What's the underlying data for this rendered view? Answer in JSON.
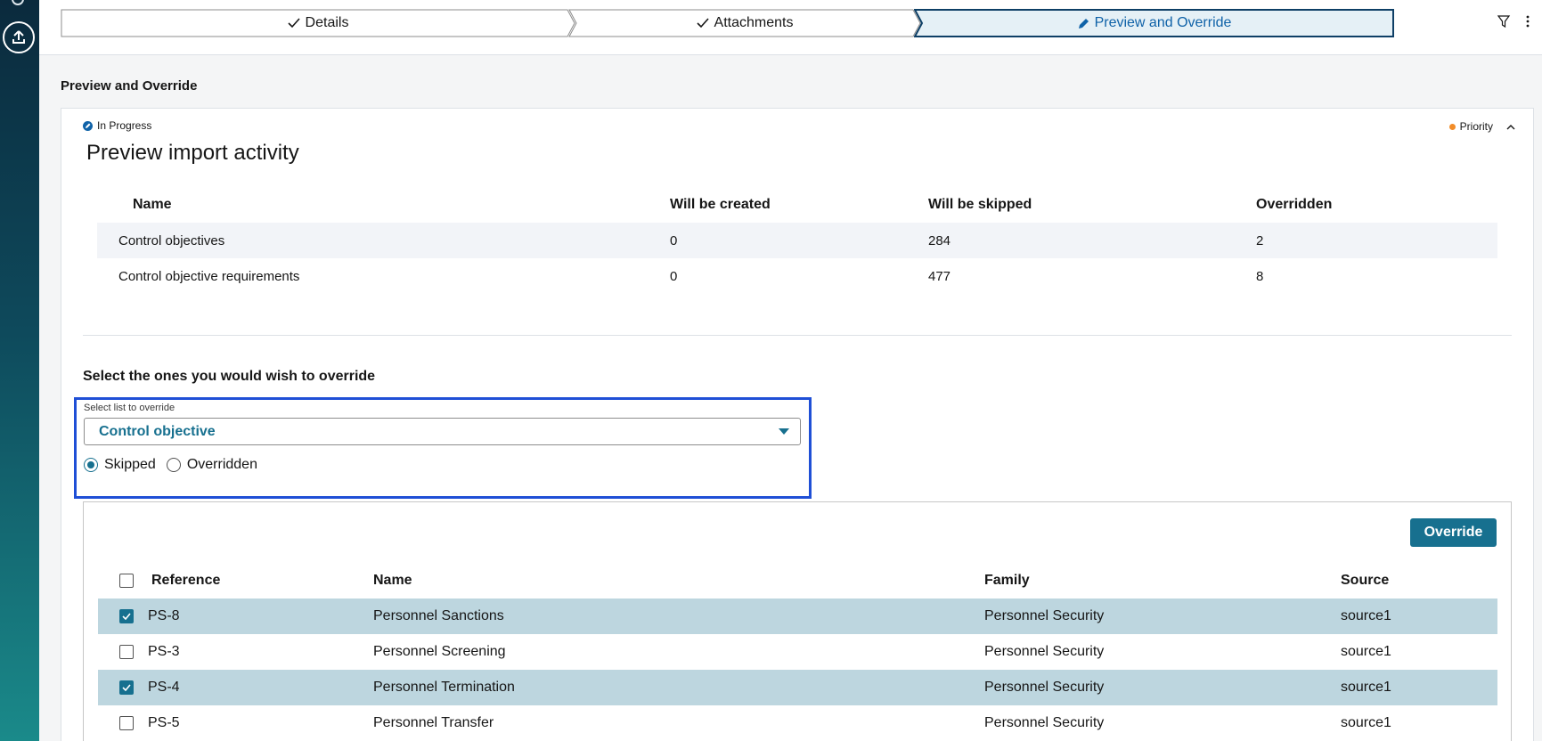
{
  "stepper": {
    "steps": [
      {
        "label": "Details",
        "state": "done"
      },
      {
        "label": "Attachments",
        "state": "done"
      },
      {
        "label": "Preview and Override",
        "state": "active"
      }
    ]
  },
  "page": {
    "section_title": "Preview and Override"
  },
  "card": {
    "status": "In Progress",
    "priority": "Priority",
    "title": "Preview import activity"
  },
  "summary": {
    "headers": {
      "name": "Name",
      "created": "Will be created",
      "skipped": "Will be skipped",
      "overridden": "Overridden"
    },
    "rows": [
      {
        "name": "Control objectives",
        "created": "0",
        "skipped": "284",
        "overridden": "2"
      },
      {
        "name": "Control objective requirements",
        "created": "0",
        "skipped": "477",
        "overridden": "8"
      }
    ]
  },
  "override": {
    "heading": "Select the ones you would wish to override",
    "dropdown_label": "Select list to override",
    "dropdown_value": "Control objective",
    "radio_skipped": "Skipped",
    "radio_overridden": "Overridden",
    "selected_radio": "Skipped",
    "button": "Override"
  },
  "items": {
    "headers": {
      "reference": "Reference",
      "name": "Name",
      "family": "Family",
      "source": "Source"
    },
    "rows": [
      {
        "reference": "PS-8",
        "name": "Personnel Sanctions",
        "family": "Personnel Security",
        "source": "source1",
        "checked": true
      },
      {
        "reference": "PS-3",
        "name": "Personnel Screening",
        "family": "Personnel Security",
        "source": "source1",
        "checked": false
      },
      {
        "reference": "PS-4",
        "name": "Personnel Termination",
        "family": "Personnel Security",
        "source": "source1",
        "checked": true
      },
      {
        "reference": "PS-5",
        "name": "Personnel Transfer",
        "family": "Personnel Security",
        "source": "source1",
        "checked": false
      }
    ]
  },
  "colors": {
    "accent": "#17708f",
    "highlight_border": "#1f4fd6",
    "selected_row": "#bdd6df",
    "priority_dot": "#f28c28"
  }
}
